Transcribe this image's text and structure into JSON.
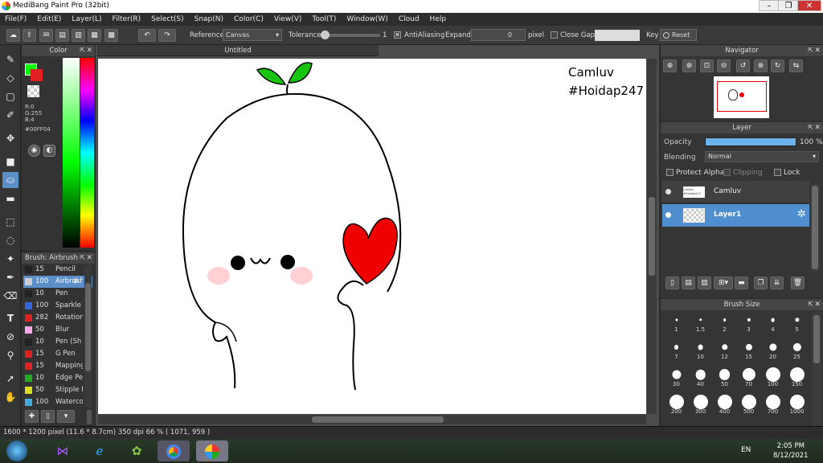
{
  "window": {
    "title": "MediBang Paint Pro (32bit)"
  },
  "menu": [
    "File(F)",
    "Edit(E)",
    "Layer(L)",
    "Filter(R)",
    "Select(S)",
    "Snap(N)",
    "Color(C)",
    "View(V)",
    "Tool(T)",
    "Window(W)",
    "Cloud",
    "Help"
  ],
  "toolbar": {
    "reference_label": "Reference",
    "reference_value": "Canvas",
    "tolerance_label": "Tolerance",
    "tolerance_value": "1",
    "antialiasing_label": "AntiAliasing",
    "expand_label": "Expand",
    "expand_value": "0",
    "expand_unit": "pixel",
    "close_gaps_label": "Close Gaps",
    "key_label": "Key",
    "reset_label": "Reset"
  },
  "color_panel": {
    "title": "Color",
    "r": "R:0",
    "g": "G:255",
    "b": "B:4",
    "hex": "#00FF04",
    "primary_color": "#00ff04",
    "secondary_color": "#e02020"
  },
  "brush_panel": {
    "title": "Brush: Airbrush",
    "items": [
      {
        "size": "15",
        "name": "Pencil",
        "color": "#222222"
      },
      {
        "size": "100",
        "name": "Airbrush",
        "color": "#cccccc"
      },
      {
        "size": "10",
        "name": "Pen",
        "color": "#222222"
      },
      {
        "size": "100",
        "name": "Sparkle",
        "color": "#3366dd"
      },
      {
        "size": "282",
        "name": "Rotation",
        "color": "#dd2222"
      },
      {
        "size": "50",
        "name": "Blur",
        "color": "#ffaaee"
      },
      {
        "size": "10",
        "name": "Pen (Sh",
        "color": "#222222"
      },
      {
        "size": "15",
        "name": "G Pen",
        "color": "#dd2222"
      },
      {
        "size": "15",
        "name": "Mapping",
        "color": "#dd2222"
      },
      {
        "size": "10",
        "name": "Edge Pe",
        "color": "#22aa22"
      },
      {
        "size": "50",
        "name": "Stipple P",
        "color": "#dddd22"
      },
      {
        "size": "100",
        "name": "Waterco",
        "color": "#44aadd"
      }
    ]
  },
  "document": {
    "tab_title": "Untitled",
    "watermark_line1": "Camluv",
    "watermark_line2": "#Hoidap247"
  },
  "navigator": {
    "title": "Navigator"
  },
  "layer_panel": {
    "title": "Layer",
    "opacity_label": "Opacity",
    "opacity_value": "100 %",
    "opacity_fraction": 1.0,
    "blending_label": "Blending",
    "blending_value": "Normal",
    "protect_alpha_label": "Protect Alpha",
    "clipping_label": "Clipping",
    "lock_label": "Lock",
    "layers": [
      {
        "name": "Camluv",
        "thumb_text": "Camluv #Hoidap247"
      },
      {
        "name": "Layer1"
      }
    ]
  },
  "brush_size_panel": {
    "title": "Brush Size",
    "sizes": [
      "1",
      "1.5",
      "2",
      "3",
      "4",
      "5",
      "7",
      "10",
      "12",
      "15",
      "20",
      "25",
      "30",
      "40",
      "50",
      "70",
      "100",
      "150",
      "200",
      "300",
      "400",
      "500",
      "700",
      "1000"
    ]
  },
  "status": {
    "text": "1600 * 1200 pixel   (11.6 * 8.7cm)   350 dpi   66 %   ( 1071, 959 )"
  },
  "taskbar": {
    "language": "EN",
    "time": "2:05 PM",
    "date": "8/12/2021"
  }
}
